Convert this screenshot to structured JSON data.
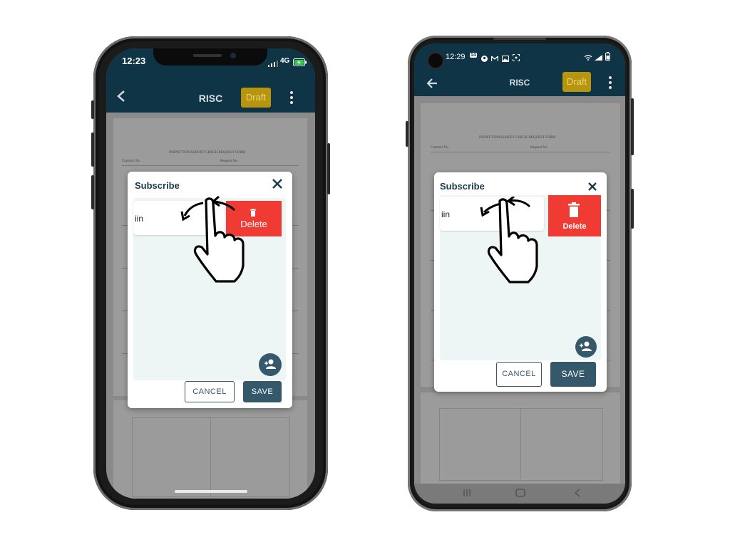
{
  "iphone": {
    "status": {
      "time": "12:23",
      "network": "4G"
    },
    "appbar": {
      "title": "RISC",
      "draft_label": "Draft"
    },
    "form_title": "INSPECTION/SURVEY CHECK REQUEST FORM",
    "form_labels": {
      "contract_no": "Contract No.",
      "request_no": "Request No."
    },
    "modal": {
      "title": "Subscribe",
      "row_text": "iin",
      "delete_label": "Delete",
      "cancel_label": "CANCEL",
      "save_label": "SAVE"
    }
  },
  "android": {
    "status": {
      "time": "12:29",
      "badge": "14"
    },
    "appbar": {
      "title": "RISC",
      "draft_label": "Draft"
    },
    "form_title": "INSPECTION/SURVEY CHECK REQUEST FORM",
    "form_labels": {
      "contract_no": "Contract No.",
      "request_no": "Request No."
    },
    "modal": {
      "title": "Subscribe",
      "row_text": "iin",
      "delete_label": "Delete",
      "cancel_label": "CANCEL",
      "save_label": "SAVE"
    }
  },
  "icons": {
    "back": "arrow-back-icon",
    "more": "kebab-menu-icon",
    "close": "close-icon",
    "delete": "trash-icon",
    "add_person": "person-add-icon",
    "gesture": "swipe-hand-icon"
  },
  "colors": {
    "appbar": "#0f3445",
    "draft": "#b8950f",
    "delete": "#ef3b34",
    "primary_button": "#35596b"
  }
}
